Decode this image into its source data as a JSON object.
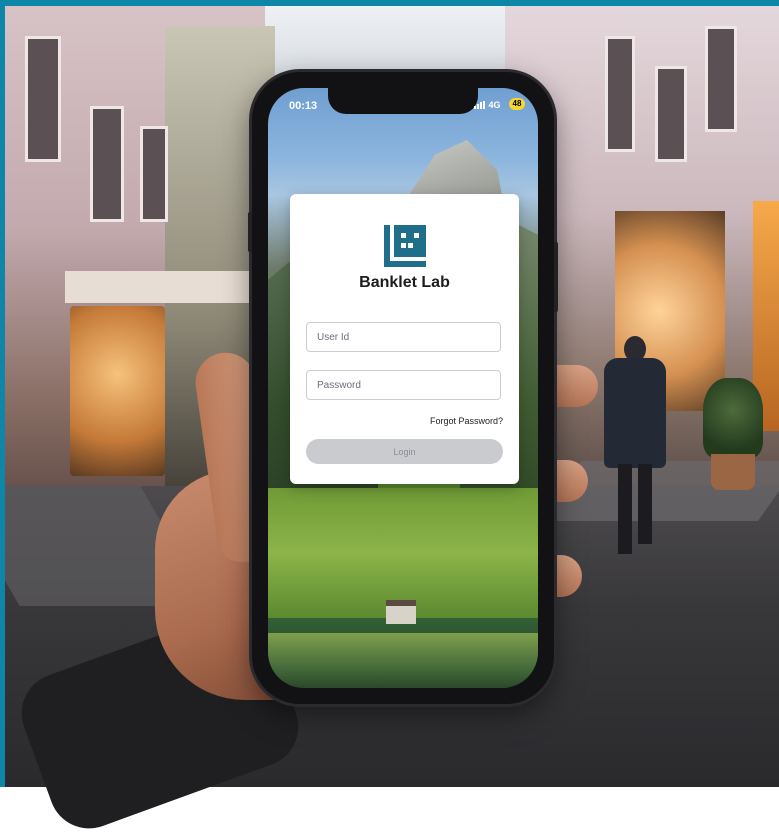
{
  "status_bar": {
    "time": "00:13",
    "network": "4G",
    "battery": "48"
  },
  "login_card": {
    "brand_name": "Banklet Lab",
    "user_id_placeholder": "User Id",
    "password_placeholder": "Password",
    "forgot_password_label": "Forgot Password?",
    "login_button_label": "Login"
  },
  "colors": {
    "frame_border": "#0e86a8",
    "brand_logo": "#1f6f8b",
    "login_button_disabled": "#c9cbcf"
  },
  "icons": [
    "banklet-logo-icon",
    "signal-icon",
    "battery-icon"
  ]
}
